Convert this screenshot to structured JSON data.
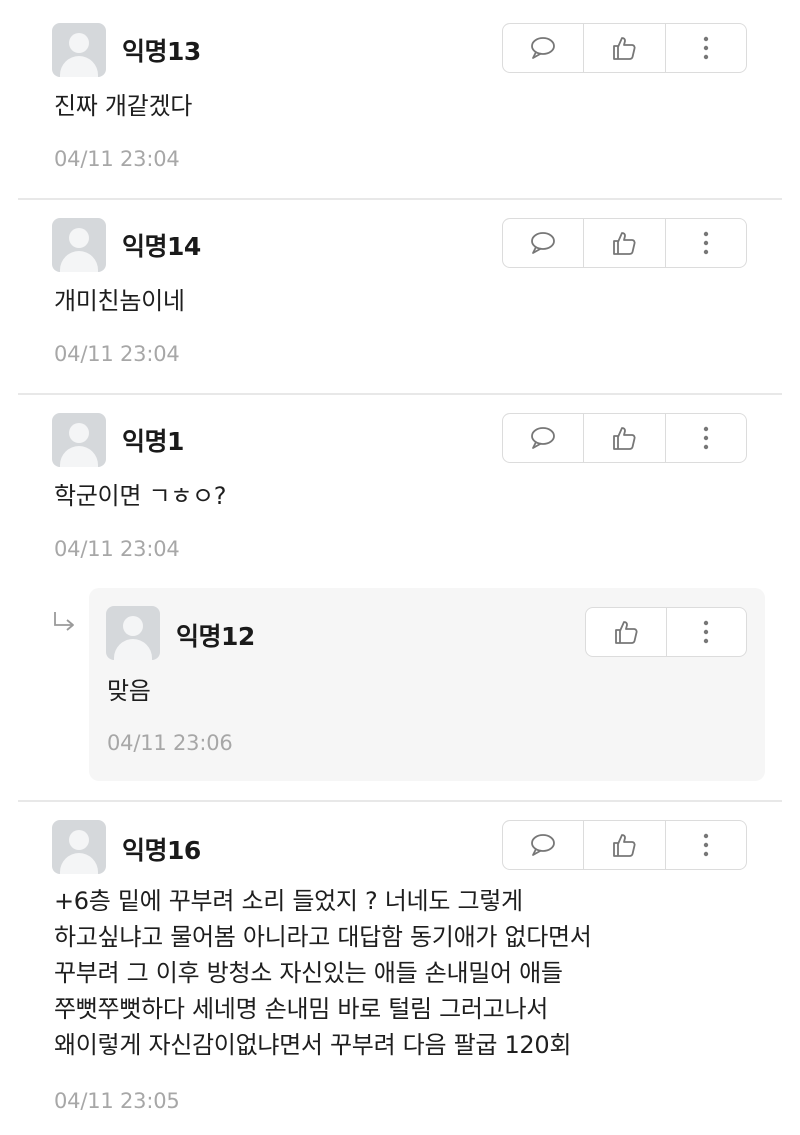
{
  "comments": [
    {
      "author": "익명13",
      "text": "진짜 개같겠다",
      "time": "04/11 23:04"
    },
    {
      "author": "익명14",
      "text": "개미친놈이네",
      "time": "04/11 23:04"
    },
    {
      "author": "익명1",
      "text": "학군이면 ㄱㅎㅇ?",
      "time": "04/11 23:04"
    },
    {
      "author": "익명12",
      "text": "맞음",
      "time": "04/11 23:06"
    },
    {
      "author": "익명16",
      "lines": [
        "+6층 밑에 꾸부려 소리 들었지 ? 너네도 그렇게",
        "하고싶냐고 물어봄 아니라고 대답함 동기애가 없다면서",
        "꾸부려 그 이후 방청소 자신있는 애들 손내밀어 애들",
        "쭈뻣쭈뻣하다 세네명 손내밈 바로 털림 그러고나서",
        "왜이렇게 자신감이없냐면서 꾸부려 다음 팔굽 120회"
      ],
      "time": "04/11 23:05"
    }
  ],
  "icons": {
    "reply": "speech-bubble-icon",
    "like": "thumbs-up-icon",
    "more": "vertical-ellipsis-icon",
    "nested": "reply-arrow-icon"
  },
  "colors": {
    "timestamp": "#a7a7a7",
    "avatar": "#d5d8db",
    "reply_bg": "#f6f6f6",
    "border": "#dcdcdc"
  }
}
